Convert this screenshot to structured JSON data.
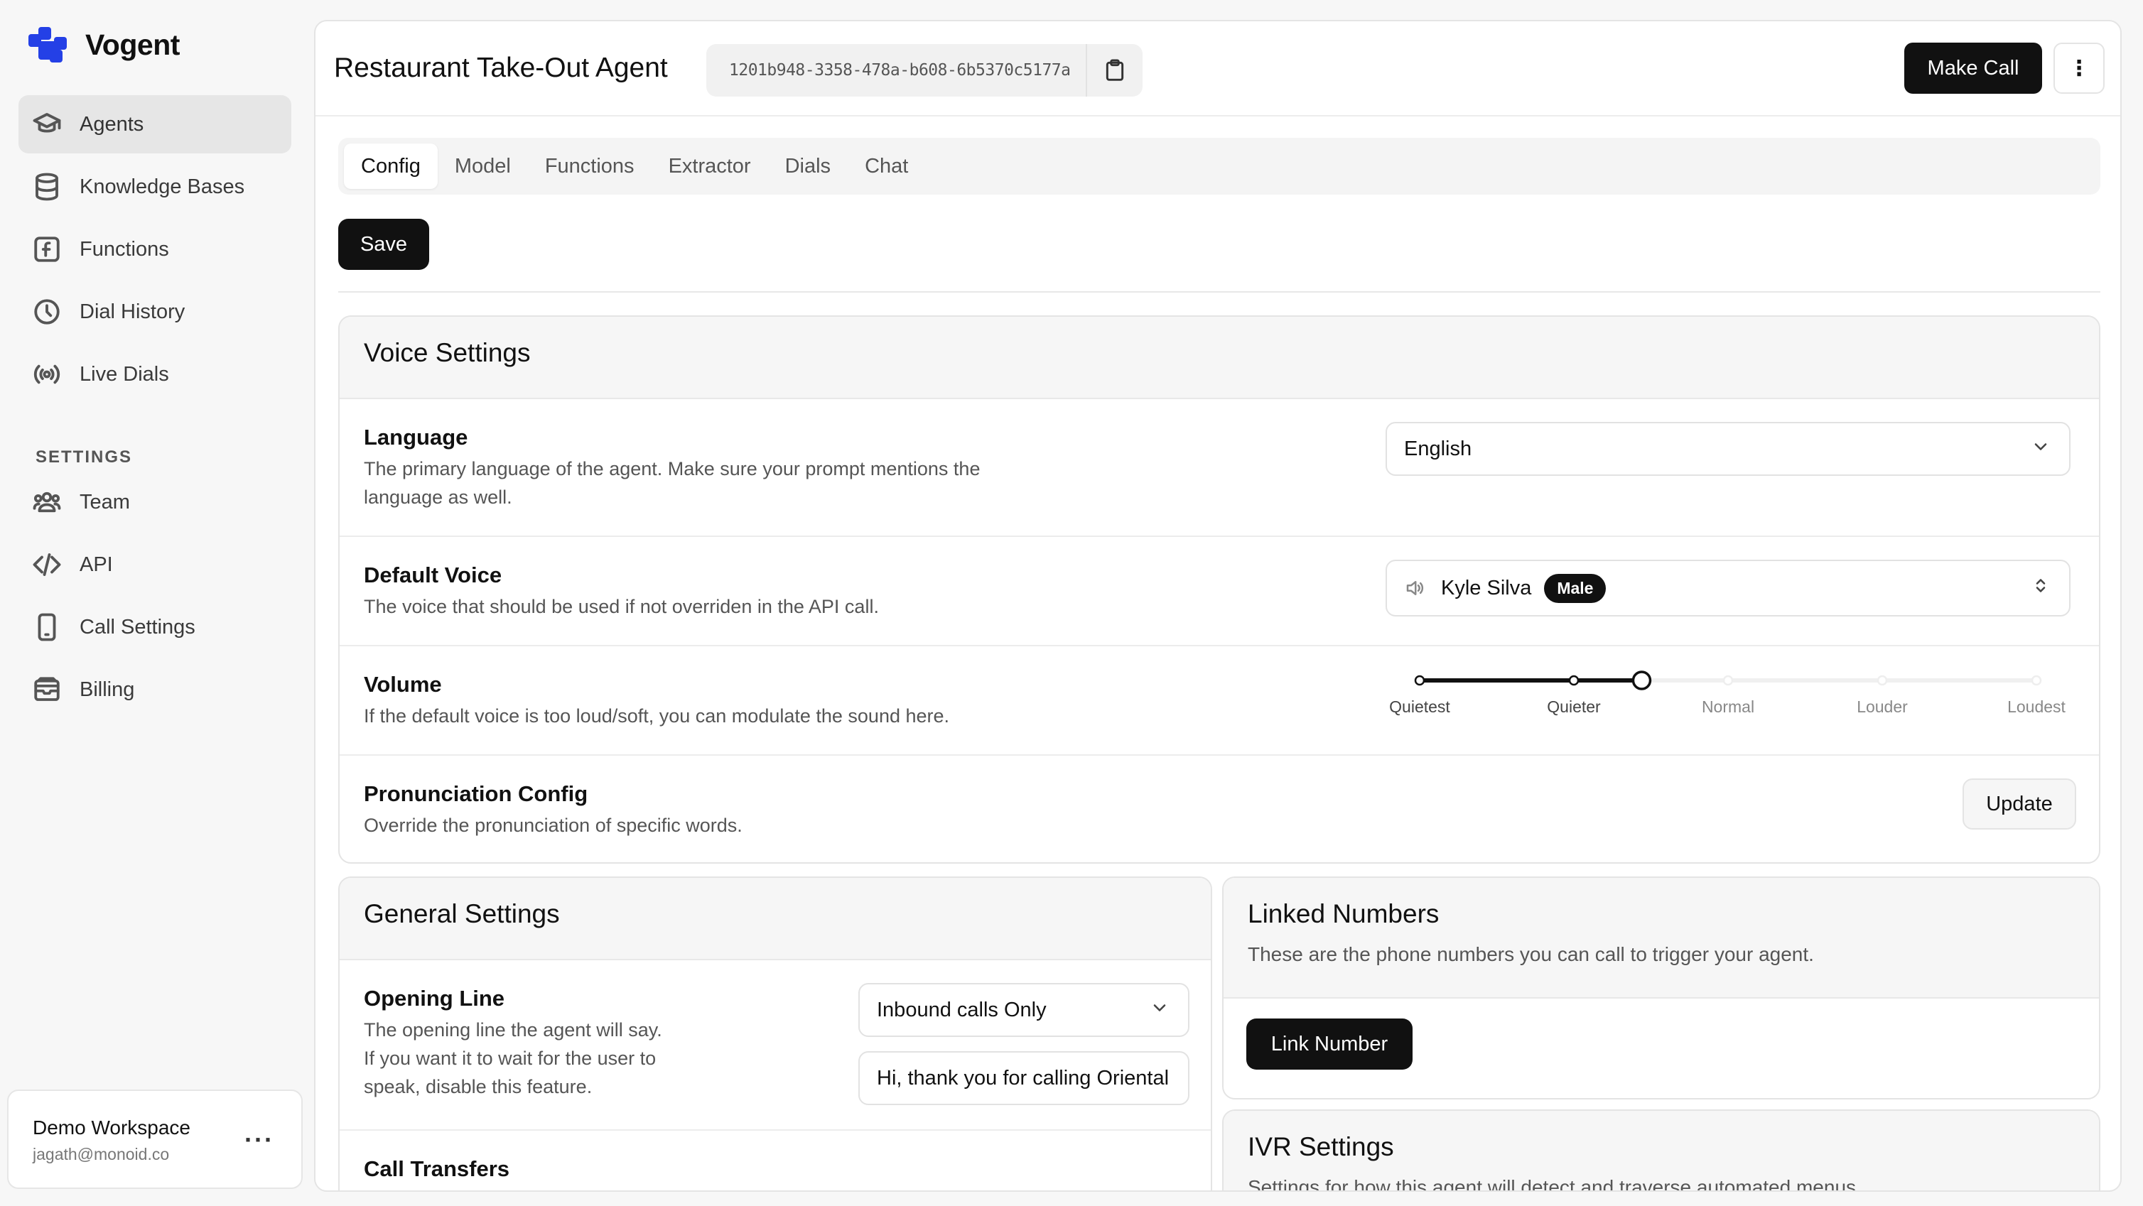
{
  "app": {
    "name": "Vogent",
    "brand_color": "#2440e6"
  },
  "sidebar": {
    "items": [
      {
        "label": "Agents",
        "icon": "graduation-cap-icon",
        "active": true
      },
      {
        "label": "Knowledge Bases",
        "icon": "database-icon",
        "active": false
      },
      {
        "label": "Functions",
        "icon": "function-icon",
        "active": false
      },
      {
        "label": "Dial History",
        "icon": "clock-icon",
        "active": false
      },
      {
        "label": "Live Dials",
        "icon": "broadcast-icon",
        "active": false
      }
    ],
    "settings_label": "SETTINGS",
    "settings_items": [
      {
        "label": "Team",
        "icon": "users-icon"
      },
      {
        "label": "API",
        "icon": "code-icon"
      },
      {
        "label": "Call Settings",
        "icon": "phone-icon"
      },
      {
        "label": "Billing",
        "icon": "wallet-icon"
      }
    ],
    "workspace": {
      "name": "Demo Workspace",
      "email": "jagath@monoid.co",
      "more": "···"
    }
  },
  "header": {
    "title": "Restaurant Take-Out Agent",
    "agent_id": "1201b948-3358-478a-b608-6b5370c5177a",
    "make_call": "Make Call",
    "more": "⋮"
  },
  "tabs": [
    {
      "label": "Config",
      "active": true
    },
    {
      "label": "Model",
      "active": false
    },
    {
      "label": "Functions",
      "active": false
    },
    {
      "label": "Extractor",
      "active": false
    },
    {
      "label": "Dials",
      "active": false
    },
    {
      "label": "Chat",
      "active": false
    }
  ],
  "save_label": "Save",
  "voice_settings": {
    "title": "Voice Settings",
    "language": {
      "title": "Language",
      "desc1": "The primary language of the agent. Make sure your prompt mentions the",
      "desc2": "language as well.",
      "value": "English"
    },
    "default_voice": {
      "title": "Default Voice",
      "desc": "The voice that should be used if not overriden in the API call.",
      "voice_name": "Kyle Silva",
      "voice_badge": "Male"
    },
    "volume": {
      "title": "Volume",
      "desc": "If the default voice is too loud/soft, you can modulate the sound here.",
      "levels": [
        "Quietest",
        "Quieter",
        "Normal",
        "Louder",
        "Loudest"
      ],
      "value_fraction": 0.36
    },
    "pronunciation": {
      "title": "Pronunciation Config",
      "desc": "Override the pronunciation of specific words.",
      "button": "Update"
    }
  },
  "general_settings": {
    "title": "General Settings",
    "opening_line": {
      "title": "Opening Line",
      "desc1": "The opening line the agent will say.",
      "desc2": "If you want it to wait for the user to",
      "desc3": "speak, disable this feature.",
      "mode": "Inbound calls Only",
      "text": "Hi, thank you for calling Oriental"
    },
    "call_transfers": {
      "title": "Call Transfers"
    }
  },
  "linked_numbers": {
    "title": "Linked Numbers",
    "desc": "These are the phone numbers you can call to trigger your agent.",
    "button": "Link Number"
  },
  "ivr_settings": {
    "title": "IVR Settings",
    "desc": "Settings for how this agent will detect and traverse automated menus."
  }
}
